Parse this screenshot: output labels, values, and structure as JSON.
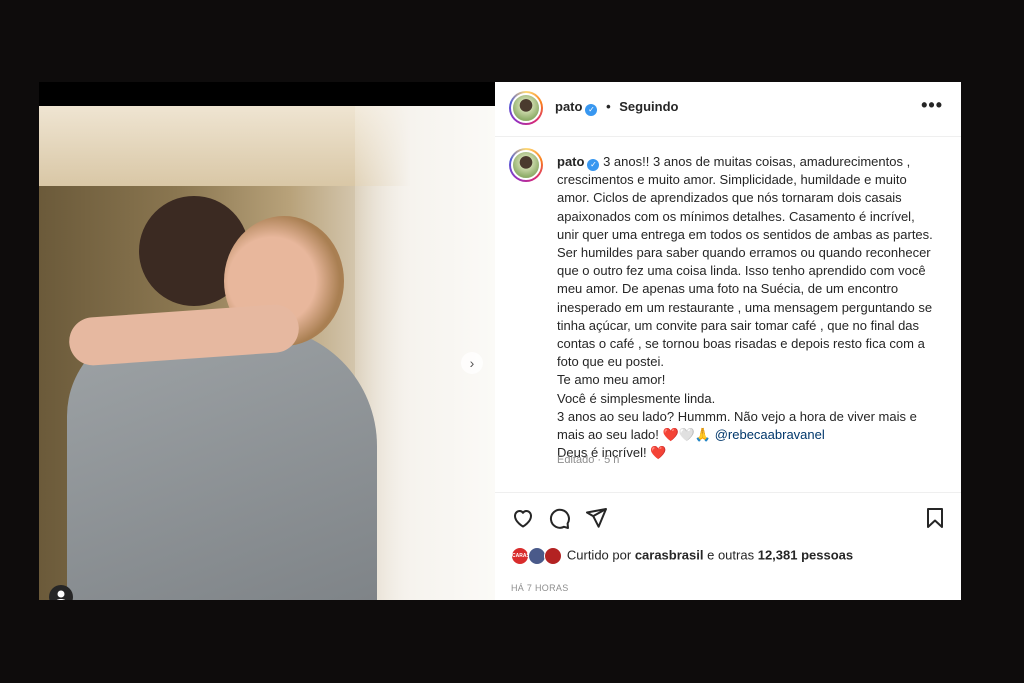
{
  "post": {
    "username": "pato",
    "verified_mark": "✓",
    "separator": "•",
    "follow_status": "Seguindo",
    "more_icon": "•••"
  },
  "media": {
    "next_arrow": "›",
    "tag_icon": "user-tag-icon"
  },
  "caption": {
    "lines": [
      "3 anos!! 3 anos de muitas coisas, amadurecimentos ,",
      "crescimentos e muito amor. Simplicidade, humildade e muito",
      "amor. Ciclos de aprendizados que nós tornaram dois casais",
      "apaixonados com os mínimos detalhes. Casamento é incrível,",
      "unir quer uma entrega em todos os sentidos de ambas as partes.",
      "Ser humildes para saber quando erramos ou quando reconhecer",
      "que o outro fez uma coisa linda. Isso tenho aprendido com você",
      "meu amor. De apenas uma foto na Suécia, de um encontro",
      "inesperado em um restaurante , uma mensagem perguntando se",
      "tinha açúcar, um convite para sair tomar café , que no final das",
      "contas o café , se tornou boas risadas e depois resto fica com a",
      "foto que eu postei.",
      "Te amo meu amor!",
      "Você é simplesmente linda.",
      "3 anos ao seu lado? Hummm. Não vejo a hora de viver mais e",
      "mais ao seu lado!"
    ],
    "emoji_line_symbols": "❤️🤍🙏",
    "mention": "@rebecaabravanel",
    "last_line": "Deus é incrível!",
    "last_heart": "❤️",
    "edited": "Editado · 5 h"
  },
  "likes": {
    "prefix": "Curtido por",
    "user": "carasbrasil",
    "connector": "e outras",
    "count": "12,381",
    "suffix": "pessoas",
    "mini_avatar_labels": [
      "CARAS",
      "",
      ""
    ]
  },
  "timestamp": "HÁ 7 HORAS",
  "colors": {
    "verified": "#3897f0",
    "heart": "#e0245e",
    "mention": "#00376b",
    "muted": "#8e8e8e"
  }
}
